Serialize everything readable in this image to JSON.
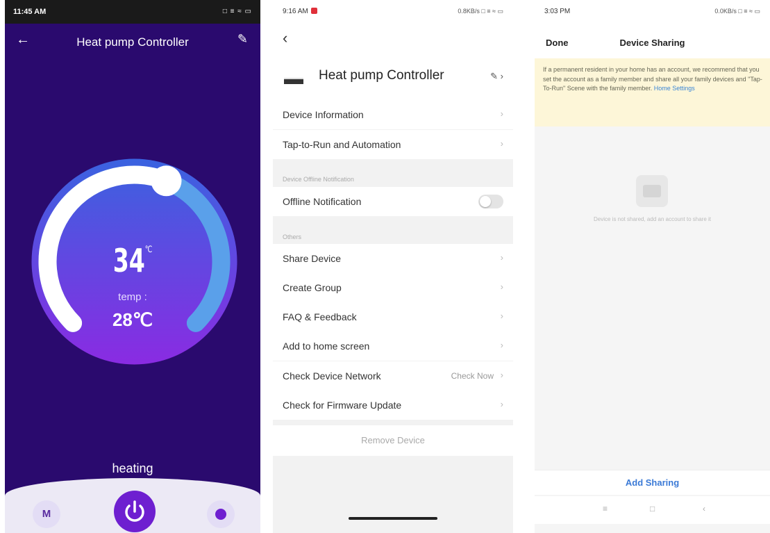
{
  "controller": {
    "status_time": "11:45 AM",
    "status_icons": "□ ≡ ≈ ▭",
    "back_icon": "arrow-left-icon",
    "title": "Heat pump Controller",
    "edit_icon": "pencil-icon",
    "setpoint": "34",
    "setpoint_unit": "℃",
    "temp_label": "temp :",
    "temp_value": "28℃",
    "mode": "heating",
    "mode_button": "M",
    "power_icon": "power-icon",
    "timer_icon": "timer-icon",
    "dial_level": 0.58,
    "colors": {
      "background": "#2a0a6e",
      "accent": "#6e1fd0"
    }
  },
  "settings": {
    "status_time": "9:16 AM",
    "status_icons": "0.8KB/s □ ≡ ≈ ▭",
    "back_icon": "chevron-left-icon",
    "device_name": "Heat pump Controller",
    "edit_icon": "pencil-icon",
    "rows_top": [
      {
        "label": "Device Information"
      },
      {
        "label": "Tap-to-Run and Automation"
      }
    ],
    "offline_section": "Device Offline Notification",
    "offline_row": {
      "label": "Offline Notification",
      "enabled": false
    },
    "others_section": "Others",
    "rows_others": [
      {
        "label": "Share Device"
      },
      {
        "label": "Create Group"
      },
      {
        "label": "FAQ & Feedback"
      },
      {
        "label": "Add to home screen"
      },
      {
        "label": "Check Device Network",
        "extra": "Check Now"
      },
      {
        "label": "Check for Firmware Update"
      }
    ],
    "chevron": "›",
    "remove_label": "Remove Device"
  },
  "sharing": {
    "status_time": "3:03 PM",
    "status_icons": "0.0KB/s □ ≡ ≈ ▭",
    "done_label": "Done",
    "title": "Device Sharing",
    "notice_text": "If a permanent resident in your home has an account, we recommend that you set the account as a family member and share all your family devices and \"Tap-To-Run\" Scene with the family member.",
    "notice_link": "Home Settings",
    "empty_message": "Device is not shared, add an account to share it",
    "add_label": "Add Sharing",
    "nav_menu": "≡",
    "nav_home": "□",
    "nav_back": "‹"
  }
}
